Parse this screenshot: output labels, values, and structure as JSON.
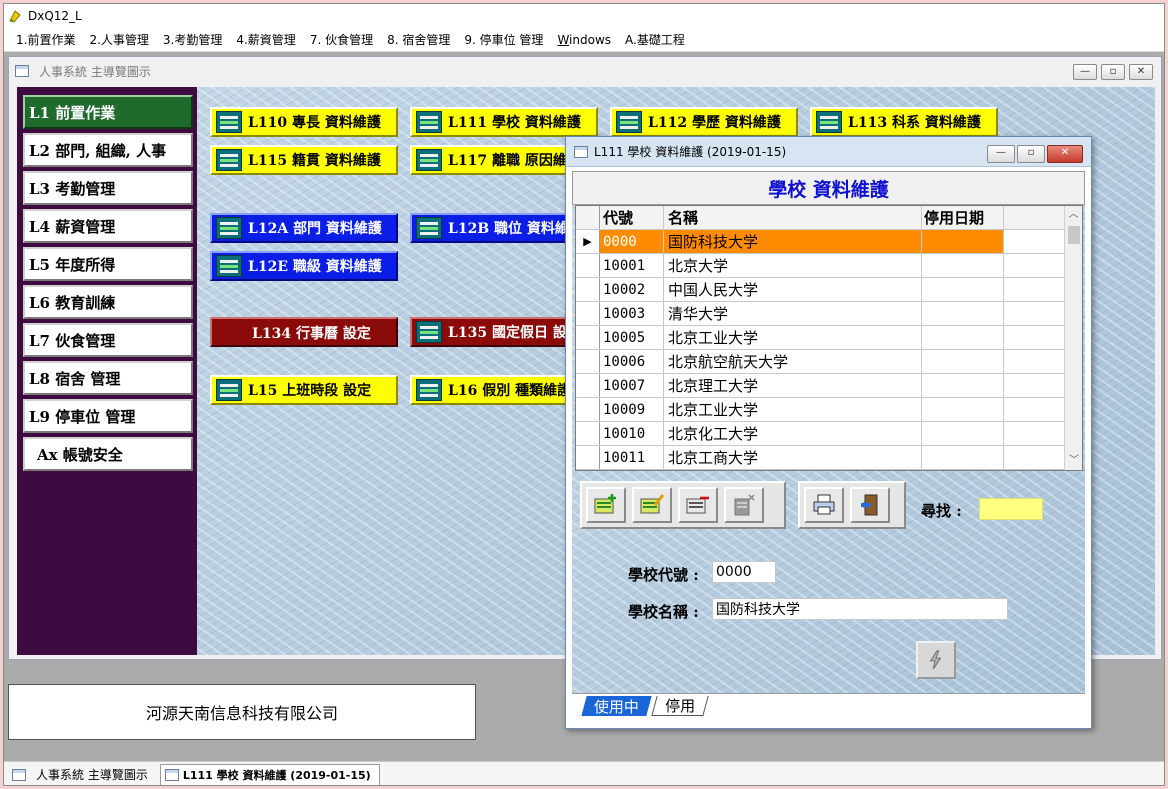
{
  "app": {
    "title": "DxQ12_L"
  },
  "menu": [
    {
      "label": "1.前置作業"
    },
    {
      "label": "2.人事管理"
    },
    {
      "label": "3.考勤管理"
    },
    {
      "label": "4.薪資管理"
    },
    {
      "label": "7. 伙食管理"
    },
    {
      "label": "8. 宿舍管理"
    },
    {
      "label": "9. 停車位 管理"
    },
    {
      "label": "Windows"
    },
    {
      "label": "A.基礎工程"
    }
  ],
  "main_window": {
    "title": "人事系統 主導覽圖示"
  },
  "left_nav": [
    {
      "label": "L1  前置作業"
    },
    {
      "label": "L2  部門, 組織, 人事"
    },
    {
      "label": "L3  考勤管理"
    },
    {
      "label": "L4  薪資管理"
    },
    {
      "label": "L5  年度所得"
    },
    {
      "label": "L6  教育訓練"
    },
    {
      "label": "L7  伙食管理"
    },
    {
      "label": "L8  宿舍  管理"
    },
    {
      "label": "L9  停車位  管理"
    },
    {
      "label": "Ax  帳號安全"
    }
  ],
  "function_buttons": {
    "l110": "L110  專長  資料維護",
    "l111": "L111  學校  資料維護",
    "l112": "L112  學歷  資料維護",
    "l113": "L113  科系  資料維護",
    "l115": "L115  籍貫  資料維護",
    "l117": "L117  離職  原因維",
    "l12a": "L12A  部門  資料維護",
    "l12b": "L12B  職位  資料維",
    "l12e": "L12E  職級  資料維護",
    "l134": "L134  行事曆  設定",
    "l135": "L135  國定假日  設",
    "l15": "L15  上班時段  設定",
    "l16": "L16  假別  種類維護"
  },
  "company": {
    "name": "河源天南信息科技有限公司"
  },
  "popup": {
    "title": "L111 學校 資料維護 (2019-01-15)",
    "heading": "學校 資料維護",
    "columns": {
      "code": "代號",
      "name": "名稱",
      "stop_date": "停用日期"
    },
    "rows": [
      {
        "code": "0000",
        "name": "国防科技大学",
        "stop_date": ""
      },
      {
        "code": "10001",
        "name": "北京大学",
        "stop_date": ""
      },
      {
        "code": "10002",
        "name": "中国人民大学",
        "stop_date": ""
      },
      {
        "code": "10003",
        "name": "清华大学",
        "stop_date": ""
      },
      {
        "code": "10005",
        "name": "北京工业大学",
        "stop_date": ""
      },
      {
        "code": "10006",
        "name": "北京航空航天大学",
        "stop_date": ""
      },
      {
        "code": "10007",
        "name": "北京理工大学",
        "stop_date": ""
      },
      {
        "code": "10009",
        "name": "北京工业大学",
        "stop_date": ""
      },
      {
        "code": "10010",
        "name": "北京化工大学",
        "stop_date": ""
      },
      {
        "code": "10011",
        "name": "北京工商大学",
        "stop_date": ""
      }
    ],
    "current_row_marker": "▶",
    "search_label": "尋找 :",
    "search_value": "",
    "school_code_label": "學校代號 :",
    "school_code_value": "0000",
    "school_name_label": "學校名稱 :",
    "school_name_value": "国防科技大学",
    "tabs": [
      {
        "label": "使用中"
      },
      {
        "label": "停用"
      }
    ]
  },
  "taskbar": [
    {
      "label": "人事系統 主導覽圖示"
    },
    {
      "label": "L111 學校 資料維護 (2019-01-15)"
    }
  ]
}
